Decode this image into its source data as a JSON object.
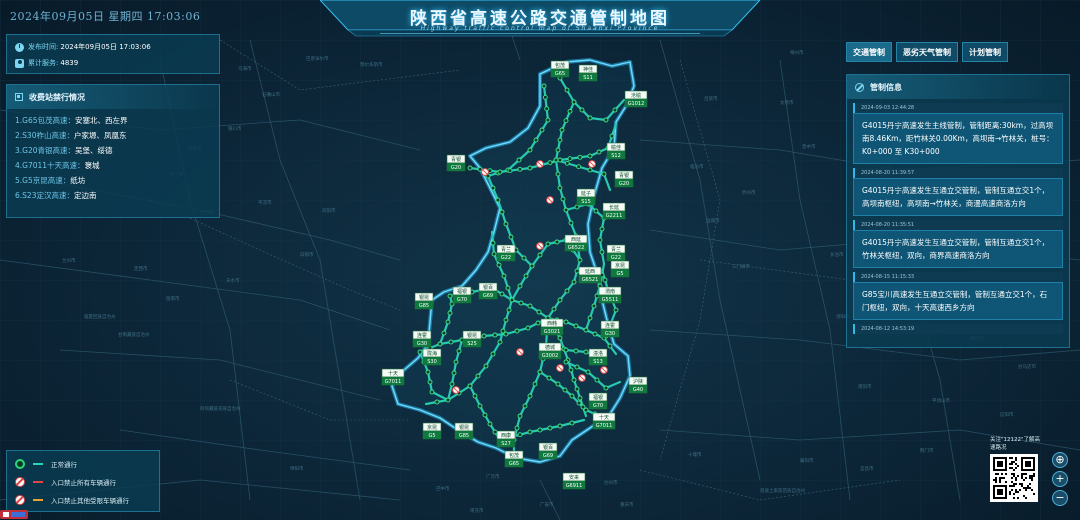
{
  "header": {
    "date": "2024年09月05日 星期四  17:03:06",
    "title": "陕西省高速公路交通管制地图",
    "subtitle": "Highway traffic control map of Shaanxi Province"
  },
  "info": {
    "publish_label": "发布时间:",
    "publish_value": "2024年09月05日 17:03:06",
    "service_label": "累计服务:",
    "service_value": "4839"
  },
  "toll": {
    "title": "收费站禁行情况",
    "items": [
      {
        "highway": "1.G65包茂高速：",
        "stations": "安塞北、西左界"
      },
      {
        "highway": "2.S30祚山高速：",
        "stations": "户家塬、凤凰东"
      },
      {
        "highway": "3.G20青银高速：",
        "stations": "吴堡、绥德"
      },
      {
        "highway": "4.G7011十天高速：",
        "stations": "褒城"
      },
      {
        "highway": "5.G5京昆高速：",
        "stations": "纸坊"
      },
      {
        "highway": "6.S23定汉高速：",
        "stations": "定边南"
      }
    ]
  },
  "tabs": [
    {
      "label": "交通管制",
      "active": true
    },
    {
      "label": "恶劣天气管制",
      "active": false
    },
    {
      "label": "计划管制",
      "active": false
    }
  ],
  "control": {
    "title": "管制信息",
    "items": [
      {
        "time": "2024-09-03 12:44:28",
        "text": "G4015丹宁高速发生主线管制，管制距离:30km，过高坝南8.46Km，距竹林关0.00Km，高坝南→竹林关，桩号：K0+000 至 K30+000"
      },
      {
        "time": "2024-08-20 11:39:57",
        "text": "G4015丹宁高速发生互通立交管制，管制互通立交1个，高坝南枢纽，高坝南→竹林关，商漫高速商洛方向"
      },
      {
        "time": "2024-08-20 11:35:51",
        "text": "G4015丹宁高速发生互通立交管制，管制互通立交1个，竹林关枢纽，双向，商界高速商洛方向"
      },
      {
        "time": "2024-08-15 11:15:33",
        "text": "G85宝川高速发生互通立交管制，管制互通立交1个，石门枢纽，双向，十天高速西乡方向"
      },
      {
        "time": "2024-08-12 14:53:19",
        "text": ""
      }
    ]
  },
  "legend": [
    {
      "label": "正常通行",
      "icon_color": "#2fd47a",
      "line_color": "#28d6b4",
      "icon": "dot-icon"
    },
    {
      "label": "入口禁止所有车辆通行",
      "icon_color": "#e04848",
      "line_color": "#e04848",
      "icon": "no-entry-icon"
    },
    {
      "label": "入口禁止其他受限车辆通行",
      "icon_color": "#e04848",
      "line_color": "#f0a030",
      "icon": "no-entry-icon"
    }
  ],
  "qr": {
    "text": "关注\"12122\"了解高速路况"
  },
  "zoom": {
    "locate": "⊕",
    "plus": "+",
    "minus": "−"
  },
  "map_markers": [
    {
      "name": "包茂",
      "code": "G65"
    },
    {
      "name": "神佳",
      "code": "S11"
    },
    {
      "name": "沧榆",
      "code": "G1012"
    },
    {
      "name": "青银",
      "code": "G20"
    },
    {
      "name": "榆佳",
      "code": "S12"
    },
    {
      "name": "青银",
      "code": "G20"
    },
    {
      "name": "延子",
      "code": "S15"
    },
    {
      "name": "长延",
      "code": "G2211"
    },
    {
      "name": "青兰",
      "code": "G22"
    },
    {
      "name": "西延",
      "code": "G6522"
    },
    {
      "name": "青兰",
      "code": "G22"
    },
    {
      "name": "福银",
      "code": "G70"
    },
    {
      "name": "银百",
      "code": "G69"
    },
    {
      "name": "延西",
      "code": "G6521"
    },
    {
      "name": "京昆",
      "code": "G5"
    },
    {
      "name": "渭南",
      "code": "G5511"
    },
    {
      "name": "银昆",
      "code": "G85"
    },
    {
      "name": "连霍",
      "code": "G30"
    },
    {
      "name": "银昆",
      "code": "S25"
    },
    {
      "name": "西韩",
      "code": "G3021"
    },
    {
      "name": "连霍",
      "code": "G30"
    },
    {
      "name": "陇海",
      "code": "S30"
    },
    {
      "name": "德城",
      "code": "G3002"
    },
    {
      "name": "潼洛",
      "code": "S13"
    },
    {
      "name": "十天",
      "code": "G7011"
    },
    {
      "name": "沪陕",
      "code": "G40"
    },
    {
      "name": "福银",
      "code": "G70"
    },
    {
      "name": "京昆",
      "code": "G5"
    },
    {
      "name": "银昆",
      "code": "G85"
    },
    {
      "name": "十天",
      "code": "G7011"
    },
    {
      "name": "西康",
      "code": "S27"
    },
    {
      "name": "银百",
      "code": "G69"
    },
    {
      "name": "包茂",
      "code": "G65"
    },
    {
      "name": "安来",
      "code": "G6911"
    }
  ],
  "map_labels": {
    "cities": [
      "鄂尔多斯市",
      "巴彦淖尔市",
      "乌海市",
      "石嘴山市",
      "银川市",
      "吴忠市",
      "中卫市",
      "固原市",
      "平凉市",
      "庆阳市",
      "白银市",
      "天水市",
      "陇南市",
      "甘南藏族自治州",
      "定西市",
      "临夏回族自治州",
      "兰州市",
      "广元市",
      "巴中市",
      "达州市",
      "十堰市",
      "襄阳市",
      "南阳市",
      "平顶山市",
      "洛阳市",
      "三门峡市",
      "运城市",
      "临汾市",
      "吕梁市",
      "太原市",
      "晋中市",
      "忻州市",
      "长治市",
      "晋城市",
      "焦作市",
      "郑州市",
      "信阳市",
      "驻马店市",
      "许昌市",
      "漯河市",
      "宜昌市",
      "荆门市",
      "恩施土家族苗族自治州",
      "重庆市",
      "南充市",
      "广安市",
      "绵阳市",
      "阿坝藏族羌族自治州",
      "朔州市"
    ]
  }
}
